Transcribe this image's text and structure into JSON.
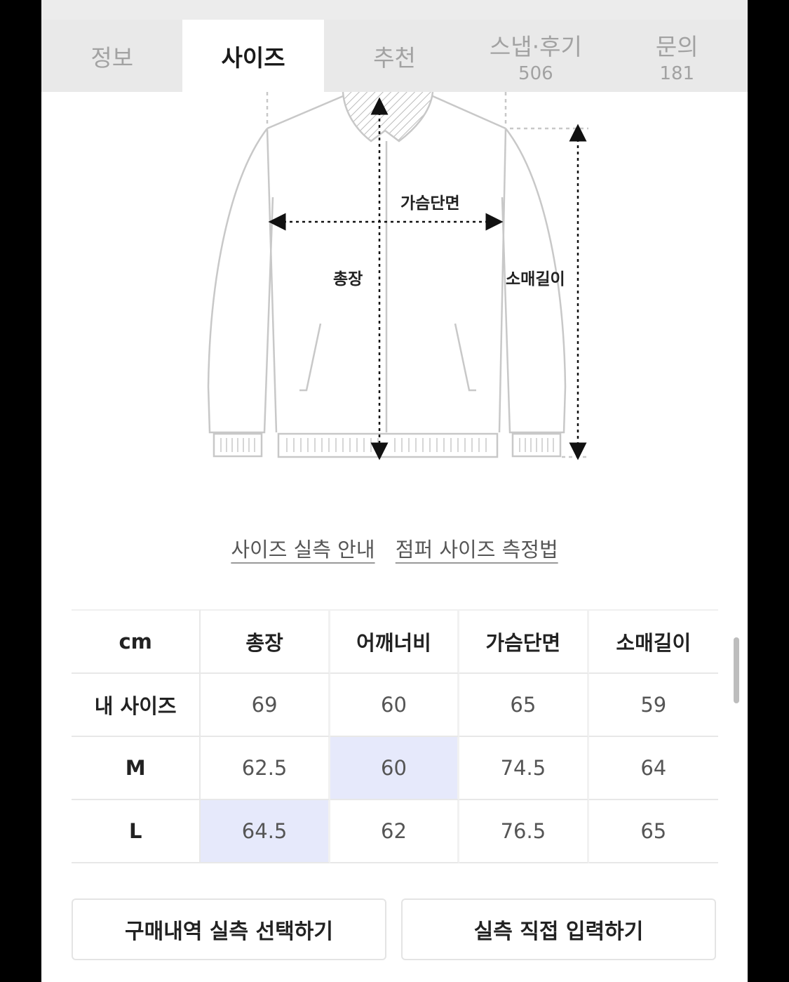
{
  "tabs": [
    {
      "label": "정보",
      "count": ""
    },
    {
      "label": "사이즈",
      "count": ""
    },
    {
      "label": "추천",
      "count": ""
    },
    {
      "label": "스냅·후기",
      "count": "506"
    },
    {
      "label": "문의",
      "count": "181"
    }
  ],
  "diagram": {
    "chest_label": "가슴단면",
    "length_label": "총장",
    "sleeve_label": "소매길이"
  },
  "links": {
    "size_guide": "사이즈 실측 안내",
    "measure_method": "점퍼 사이즈 측정법"
  },
  "table": {
    "headers": [
      "cm",
      "총장",
      "어깨너비",
      "가슴단면",
      "소매길이"
    ],
    "rows": [
      {
        "label": "내 사이즈",
        "values": [
          "69",
          "60",
          "65",
          "59"
        ]
      },
      {
        "label": "M",
        "values": [
          "62.5",
          "60",
          "74.5",
          "64"
        ]
      },
      {
        "label": "L",
        "values": [
          "64.5",
          "62",
          "76.5",
          "65"
        ]
      }
    ],
    "highlight_color": "#e6e9fb"
  },
  "buttons": {
    "purchase_history": "구매내역 실측 선택하기",
    "manual_input": "실측 직접 입력하기"
  }
}
